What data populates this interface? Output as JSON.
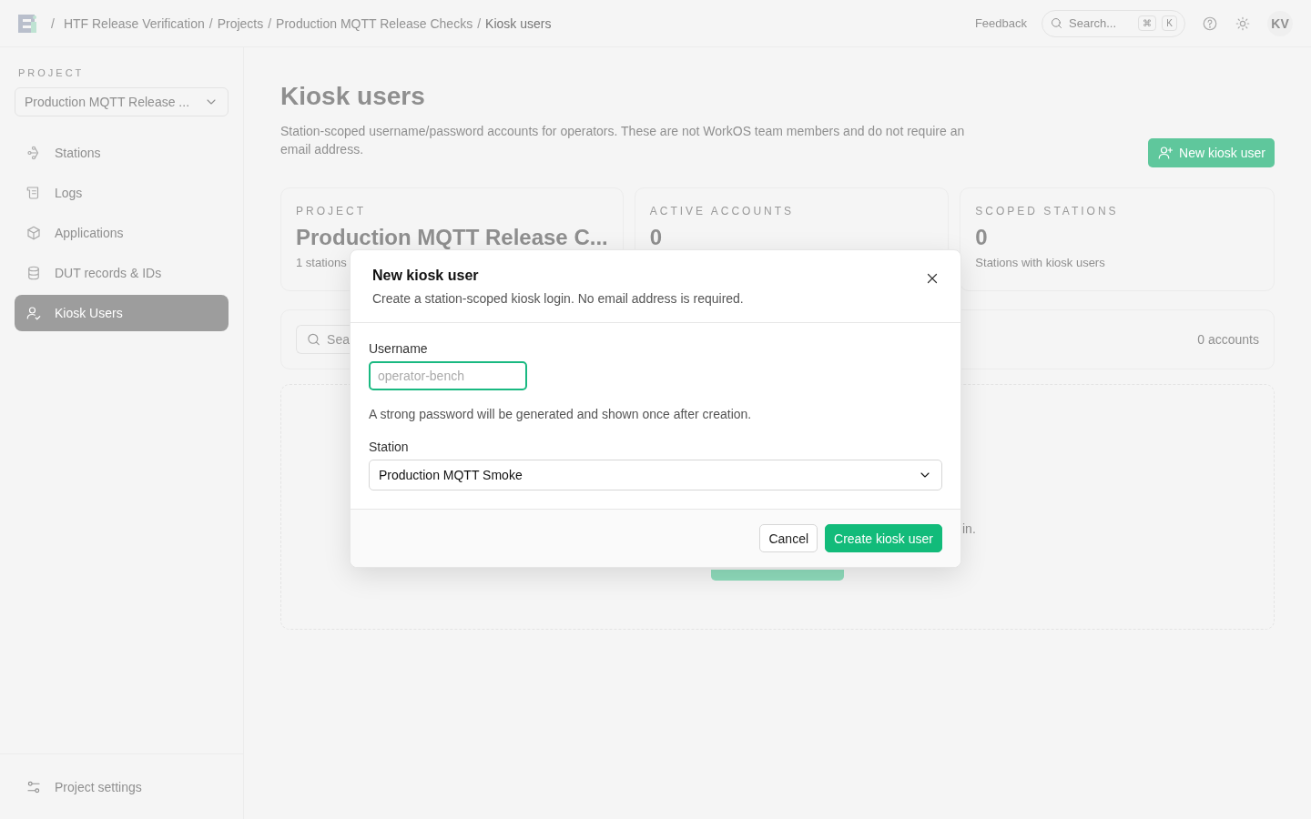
{
  "topbar": {
    "separator": "/",
    "breadcrumbs": [
      {
        "label": "HTF Release Verification",
        "current": false
      },
      {
        "label": "Projects",
        "current": false
      },
      {
        "label": "Production MQTT Release Checks",
        "current": false
      },
      {
        "label": "Kiosk users",
        "current": true
      }
    ],
    "feedback": "Feedback",
    "search": {
      "placeholder": "Search...",
      "keys": [
        "⌘",
        "K"
      ]
    },
    "avatar": "KV"
  },
  "sidebar": {
    "section_label": "PROJECT",
    "project_select": "Production MQTT Release ...",
    "items": [
      {
        "label": "Stations",
        "selected": false
      },
      {
        "label": "Logs",
        "selected": false
      },
      {
        "label": "Applications",
        "selected": false
      },
      {
        "label": "DUT records & IDs",
        "selected": false
      },
      {
        "label": "Kiosk Users",
        "selected": true
      }
    ],
    "footer_item": "Project settings"
  },
  "page": {
    "title": "Kiosk users",
    "description": "Station-scoped username/password accounts for operators. These are not WorkOS team members and do not require an email address.",
    "new_button": "New kiosk user",
    "stats": [
      {
        "label": "PROJECT",
        "value": "Production MQTT Release C...",
        "caption": "1 stations"
      },
      {
        "label": "ACTIVE ACCOUNTS",
        "value": "0"
      },
      {
        "label": "SCOPED STATIONS",
        "value": "0",
        "caption": "Stations with kiosk users"
      }
    ],
    "search_placeholder": "Sea",
    "count": "0 accounts",
    "empty_state_text": "in."
  },
  "modal": {
    "title": "New kiosk user",
    "subtitle": "Create a station-scoped kiosk login. No email address is required.",
    "username": {
      "label": "Username",
      "placeholder": "operator-bench"
    },
    "hint": "A strong password will be generated and shown once after creation.",
    "station": {
      "label": "Station",
      "value": "Production MQTT Smoke"
    },
    "buttons": [
      {
        "label": "Cancel",
        "kind": "secondary"
      },
      {
        "label": "Create kiosk user",
        "kind": "primary"
      }
    ]
  }
}
